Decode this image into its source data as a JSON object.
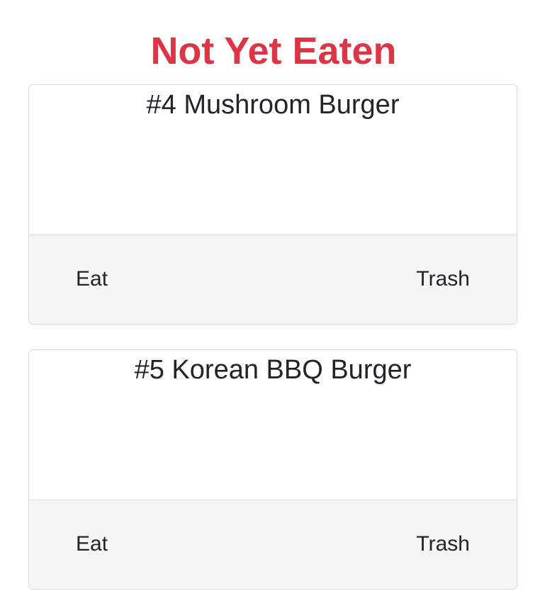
{
  "section": {
    "title": "Not Yet Eaten",
    "title_color": "#dc3545"
  },
  "burgers": [
    {
      "title": "#4 Mushroom Burger",
      "eat_label": "Eat",
      "trash_label": "Trash"
    },
    {
      "title": "#5 Korean BBQ Burger",
      "eat_label": "Eat",
      "trash_label": "Trash"
    }
  ]
}
